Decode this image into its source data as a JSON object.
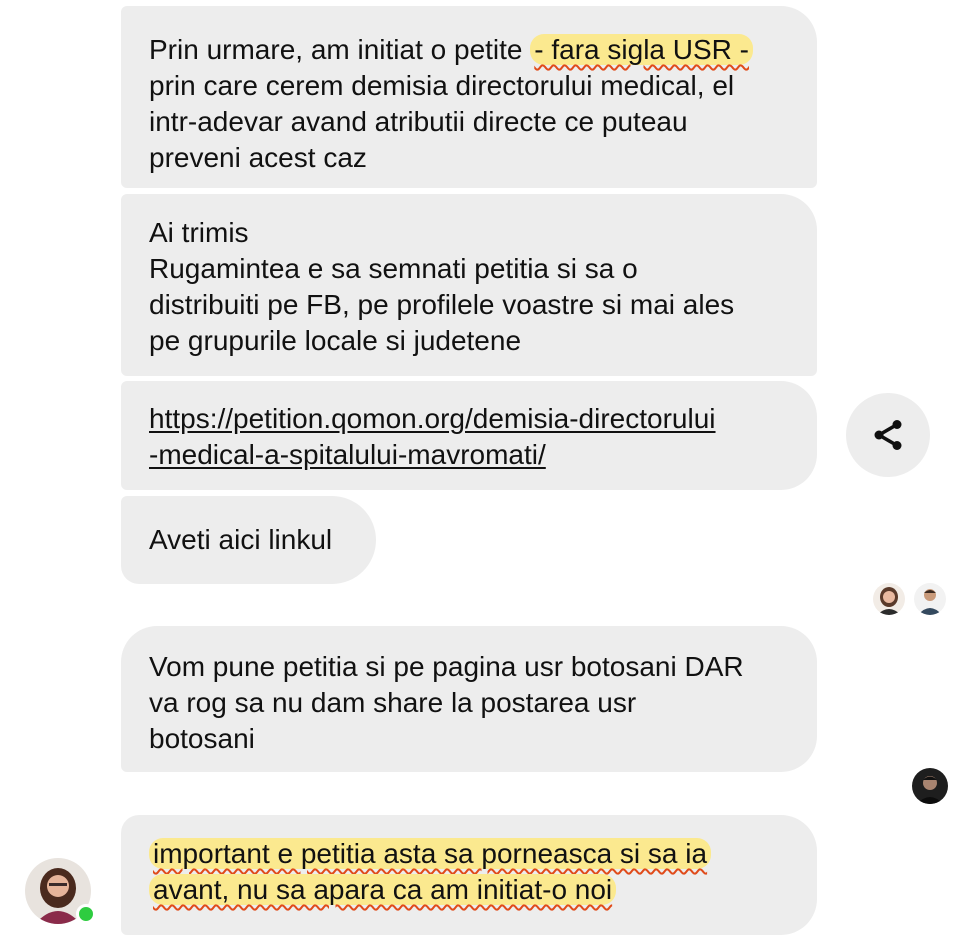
{
  "messages": [
    {
      "lines": [
        "Prin urmare, am initiat o petite ",
        "- fara sigla USR -",
        "prin care cerem demisia directorului medical, el",
        "intr-adevar avand atributii directe ce puteau",
        "preveni acest caz"
      ]
    },
    {
      "lines": [
        "Ai trimis",
        "Rugamintea e sa semnati petitia si sa o",
        "distribuiti pe FB, pe profilele voastre si mai ales",
        "pe grupurile locale si judetene"
      ]
    },
    {
      "lines": [
        "https://petition.qomon.org/demisia-directorului",
        "-medical-a-spitalului-mavromati/"
      ]
    },
    {
      "lines": [
        "Aveti aici linkul"
      ]
    },
    {
      "lines": [
        "Vom pune petitia si pe pagina usr botosani DAR",
        "va rog sa nu dam share la postarea usr",
        "botosani"
      ]
    },
    {
      "lines": [
        "important e petitia asta sa porneasca si sa ia",
        "avant, nu sa apara ca am initiat-o noi"
      ]
    }
  ],
  "icons": {
    "share": "share-icon",
    "online": "online-status-dot"
  },
  "colors": {
    "bubble": "#ededed",
    "highlight": "#fbe98f",
    "underline": "#e04b1a",
    "online": "#2ecc40"
  }
}
